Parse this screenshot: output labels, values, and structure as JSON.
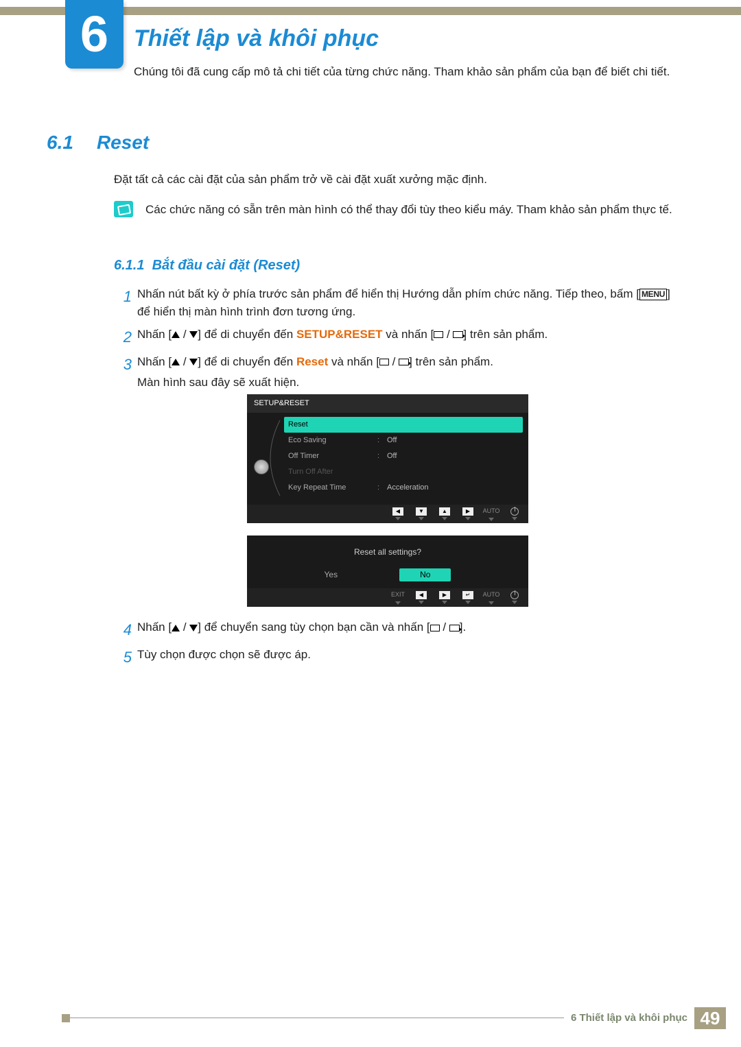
{
  "chapter": {
    "number": "6",
    "title": "Thiết lập và khôi phục"
  },
  "chapter_intro": "Chúng tôi đã cung cấp mô tả chi tiết của từng chức năng. Tham khảo sản phẩm của bạn để biết chi tiết.",
  "section": {
    "num": "6.1",
    "title": "Reset"
  },
  "section_desc": "Đặt tất cả các cài đặt của sản phẩm trở về cài đặt xuất xưởng mặc định.",
  "note_text": "Các chức năng có sẵn trên màn hình có thể thay đổi tùy theo kiểu máy. Tham khảo sản phẩm thực tế.",
  "subsection": {
    "num": "6.1.1",
    "title": "Bắt đầu cài đặt (Reset)"
  },
  "steps": {
    "s1a": "Nhấn nút bất kỳ ở phía trước sản phẩm để hiển thị Hướng dẫn phím chức năng. Tiếp theo, bấm [",
    "s1_menu": "MENU",
    "s1b": "] để hiển thị màn hình trình đơn tương ứng.",
    "s2a": "Nhấn [",
    "s2b": "] để di chuyển đến ",
    "s2_em": "SETUP&RESET",
    "s2c": " và nhấn [",
    "s2d": "] trên sản phẩm.",
    "s3a": "Nhấn [",
    "s3b": "] để di chuyển đến ",
    "s3_em": "Reset",
    "s3c": " và nhấn [",
    "s3d": "] trên sản phẩm.",
    "s3e": "Màn hình sau đây sẽ xuất hiện.",
    "s4a": "Nhấn [",
    "s4b": "] để chuyển sang tùy chọn bạn cần và nhấn [",
    "s4c": "].",
    "s5": "Tùy chọn được chọn sẽ được áp."
  },
  "step_nums": {
    "n1": "1",
    "n2": "2",
    "n3": "3",
    "n4": "4",
    "n5": "5"
  },
  "osd": {
    "header": "SETUP&RESET",
    "items": [
      {
        "label": "Reset",
        "val": ""
      },
      {
        "label": "Eco Saving",
        "val": "Off"
      },
      {
        "label": "Off Timer",
        "val": "Off"
      },
      {
        "label": "Turn Off After",
        "val": ""
      },
      {
        "label": "Key Repeat Time",
        "val": "Acceleration"
      }
    ],
    "auto": "AUTO",
    "dialog": {
      "text": "Reset all settings?",
      "yes": "Yes",
      "no": "No",
      "exit": "EXIT"
    }
  },
  "navsym": {
    "left": "◀",
    "down": "▼",
    "up": "▲",
    "right": "▶",
    "enter": "↵"
  },
  "footer": {
    "chapter": "6 Thiết lập và khôi phục",
    "page": "49"
  }
}
